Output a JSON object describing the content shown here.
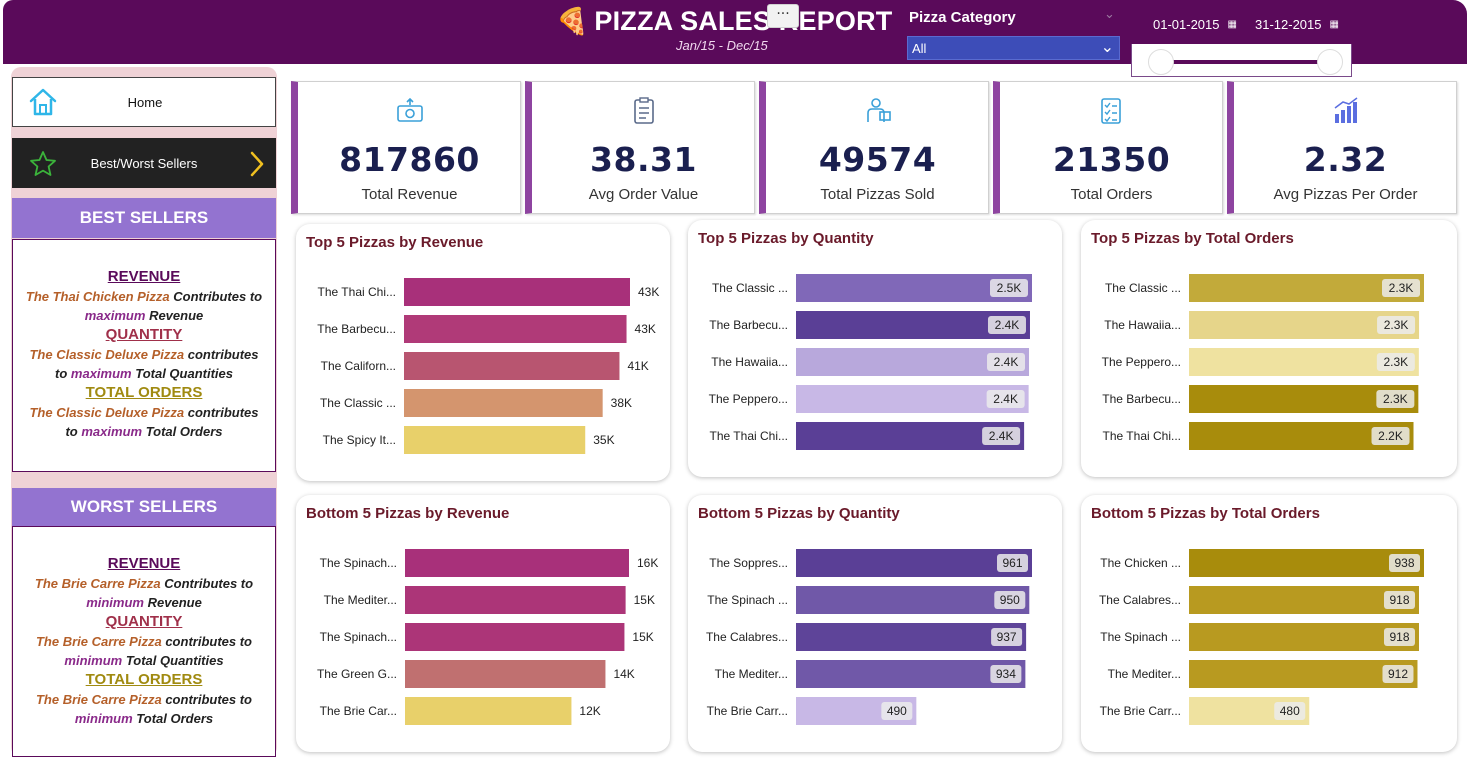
{
  "header": {
    "title": "PIZZA SALES REPORT",
    "subtitle": "Jan/15 - Dec/15",
    "more_label": "···",
    "category_label": "Pizza Category",
    "category_value": "All",
    "date_start": "01-01-2015",
    "date_end": "31-12-2015",
    "bg_color": "#5a0a5a",
    "select_color": "#3d4db8"
  },
  "sidebar": {
    "home_label": "Home",
    "best_worst_label": "Best/Worst Sellers",
    "best": {
      "heading": "BEST SELLERS",
      "revenue_head": "REVENUE",
      "revenue_pizza": "The Thai Chicken Pizza",
      "revenue_text1": "Contributes to",
      "revenue_em": "maximum",
      "revenue_text2": "Revenue",
      "quantity_head": "QUANTITY",
      "quantity_pizza": "The Classic Deluxe Pizza",
      "quantity_text1": "contributes",
      "quantity_pre": "to",
      "quantity_em": "maximum",
      "quantity_text2": "Total Quantities",
      "orders_head": "TOTAL ORDERS",
      "orders_pizza": "The Classic Deluxe Pizza",
      "orders_text1": "contributes",
      "orders_pre": "to",
      "orders_em": "maximum",
      "orders_text2": "Total Orders"
    },
    "worst": {
      "heading": "WORST SELLERS",
      "revenue_head": "REVENUE",
      "revenue_pizza": "The Brie Carre Pizza",
      "revenue_text1": "Contributes to",
      "revenue_em": "minimum",
      "revenue_text2": "Revenue",
      "quantity_head": "QUANTITY",
      "quantity_pizza": "The Brie Carre Pizza",
      "quantity_text1": "contributes to",
      "quantity_em": "minimum",
      "quantity_text2": "Total Quantities",
      "orders_head": "TOTAL ORDERS",
      "orders_pizza": "The Brie Carre Pizza",
      "orders_text1": "contributes to",
      "orders_em": "minimum",
      "orders_text2": "Total Orders"
    }
  },
  "kpis": [
    {
      "value": "817860",
      "label": "Total Revenue",
      "icon": "money-icon"
    },
    {
      "value": "38.31",
      "label": "Avg Order Value",
      "icon": "clipboard-icon"
    },
    {
      "value": "49574",
      "label": "Total Pizzas Sold",
      "icon": "delivery-icon"
    },
    {
      "value": "21350",
      "label": "Total Orders",
      "icon": "checklist-icon"
    },
    {
      "value": "2.32",
      "label": "Avg Pizzas Per Order",
      "icon": "bar-growth-icon"
    }
  ],
  "chart_data": [
    {
      "type": "bar",
      "title": "Top 5 Pizzas by Revenue",
      "categories": [
        "The Thai Chi...",
        "The Barbecu...",
        "The Californ...",
        "The Classic ...",
        "The Spicy It..."
      ],
      "values": [
        43434,
        42768,
        41410,
        38180,
        34831
      ],
      "labels": [
        "43K",
        "43K",
        "41K",
        "38K",
        "35K"
      ],
      "colors": [
        "#a8307a",
        "#b03a78",
        "#b85570",
        "#d4956e",
        "#e8d06a"
      ],
      "label_style": "outside"
    },
    {
      "type": "bar",
      "title": "Top 5 Pizzas by Quantity",
      "categories": [
        "The Classic ...",
        "The Barbecu...",
        "The Hawaiia...",
        "The Peppero...",
        "The Thai Chi..."
      ],
      "values": [
        2453,
        2432,
        2422,
        2418,
        2371
      ],
      "labels": [
        "2.5K",
        "2.4K",
        "2.4K",
        "2.4K",
        "2.4K"
      ],
      "colors": [
        "#8068b8",
        "#5a3f96",
        "#b8a8dc",
        "#c8b8e6",
        "#5a3f96"
      ],
      "label_style": "inside"
    },
    {
      "type": "bar",
      "title": "Top 5 Pizzas by Total Orders",
      "categories": [
        "The Classic ...",
        "The Hawaiia...",
        "The Peppero...",
        "The Barbecu...",
        "The Thai Chi..."
      ],
      "values": [
        2329,
        2280,
        2278,
        2273,
        2225
      ],
      "labels": [
        "2.3K",
        "2.3K",
        "2.3K",
        "2.3K",
        "2.2K"
      ],
      "colors": [
        "#c2aa3a",
        "#e6d58a",
        "#efe2a0",
        "#a88c0c",
        "#a88c0c"
      ],
      "label_style": "inside"
    },
    {
      "type": "bar",
      "title": "Bottom 5 Pizzas by Revenue",
      "categories": [
        "The Spinach...",
        "The Mediter...",
        "The Spinach...",
        "The Green G...",
        "The Brie Car..."
      ],
      "values": [
        15596,
        15360,
        15278,
        13956,
        11588
      ],
      "labels": [
        "16K",
        "15K",
        "15K",
        "14K",
        "12K"
      ],
      "colors": [
        "#a8307a",
        "#ac3578",
        "#ac3578",
        "#c07070",
        "#e8d06a"
      ],
      "label_style": "outside"
    },
    {
      "type": "bar",
      "title": "Bottom 5 Pizzas by Quantity",
      "categories": [
        "The Soppres...",
        "The Spinach ...",
        "The Calabres...",
        "The Mediter...",
        "The Brie Carr..."
      ],
      "values": [
        961,
        950,
        937,
        934,
        490
      ],
      "labels": [
        "961",
        "950",
        "937",
        "934",
        "490"
      ],
      "colors": [
        "#5a3f96",
        "#7058a8",
        "#5e4499",
        "#7058a8",
        "#c8b8e6"
      ],
      "label_style": "inside"
    },
    {
      "type": "bar",
      "title": "Bottom 5 Pizzas by Total Orders",
      "categories": [
        "The Chicken ...",
        "The Calabres...",
        "The Spinach ...",
        "The Mediter...",
        "The Brie Carr..."
      ],
      "values": [
        938,
        918,
        918,
        912,
        480
      ],
      "labels": [
        "938",
        "918",
        "918",
        "912",
        "480"
      ],
      "colors": [
        "#a88c0c",
        "#b89a20",
        "#b89a20",
        "#b89a20",
        "#efe2a0"
      ],
      "label_style": "inside"
    }
  ]
}
